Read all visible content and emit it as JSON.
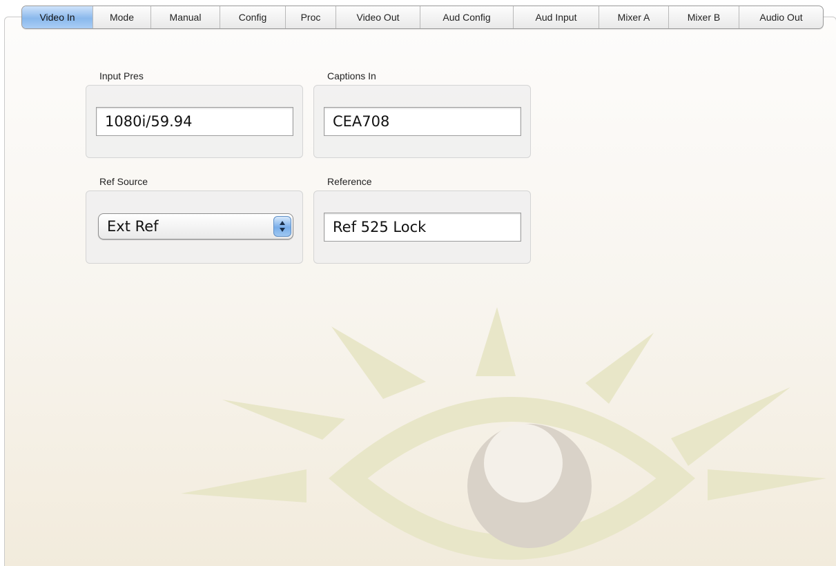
{
  "tabs": [
    {
      "label": "Video In",
      "active": true
    },
    {
      "label": "Mode",
      "active": false
    },
    {
      "label": "Manual",
      "active": false
    },
    {
      "label": "Config",
      "active": false
    },
    {
      "label": "Proc",
      "active": false
    },
    {
      "label": "Video Out",
      "active": false
    },
    {
      "label": "Aud Config",
      "active": false
    },
    {
      "label": "Aud Input",
      "active": false
    },
    {
      "label": "Mixer A",
      "active": false
    },
    {
      "label": "Mixer B",
      "active": false
    },
    {
      "label": "Audio Out",
      "active": false
    }
  ],
  "input_pres": {
    "label": "Input Pres",
    "value": "1080i/59.94"
  },
  "captions_in": {
    "label": "Captions In",
    "value": "CEA708"
  },
  "ref_source": {
    "label": "Ref Source",
    "selected": "Ext Ref"
  },
  "reference": {
    "label": "Reference",
    "value": "Ref 525 Lock"
  },
  "icons": {
    "popup_arrows": "up-down-arrows-icon",
    "watermark": "eye-logo-icon"
  },
  "colors": {
    "active_tab": "#8ab8ec",
    "watermark_rays": "#e8e6c8",
    "watermark_iris": "#d9d2c8"
  }
}
